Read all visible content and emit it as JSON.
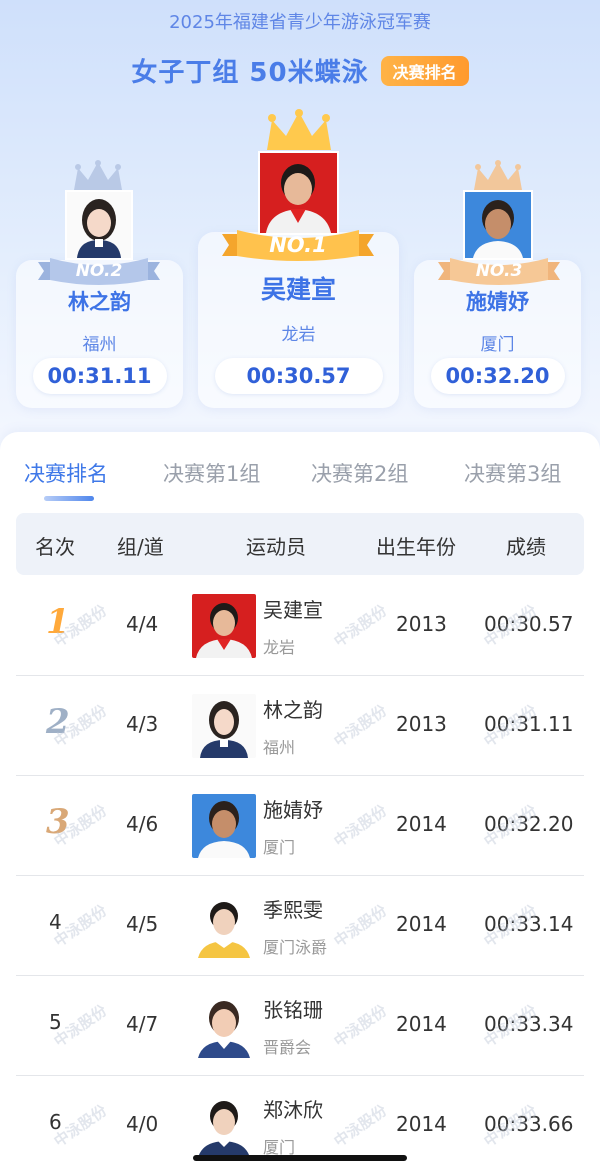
{
  "event": {
    "competition": "2025年福建省青少年游泳冠军赛",
    "title": "女子丁组 50米蝶泳",
    "badge": "决赛排名"
  },
  "podium": {
    "first": {
      "rank_label": "NO.1",
      "name": "吴建宣",
      "city": "龙岩",
      "time": "00:30.57"
    },
    "second": {
      "rank_label": "NO.2",
      "name": "林之韵",
      "city": "福州",
      "time": "00:31.11"
    },
    "third": {
      "rank_label": "NO.3",
      "name": "施婧妤",
      "city": "厦门",
      "time": "00:32.20"
    }
  },
  "tabs": [
    {
      "label": "决赛排名",
      "active": true
    },
    {
      "label": "决赛第1组",
      "active": false
    },
    {
      "label": "决赛第2组",
      "active": false
    },
    {
      "label": "决赛第3组",
      "active": false
    }
  ],
  "table": {
    "headers": [
      "名次",
      "组/道",
      "运动员",
      "出生年份",
      "成绩"
    ],
    "rows": [
      {
        "rank": "1",
        "lane": "4/4",
        "name": "吴建宣",
        "team": "龙岩",
        "year": "2013",
        "result": "00:30.57"
      },
      {
        "rank": "2",
        "lane": "4/3",
        "name": "林之韵",
        "team": "福州",
        "year": "2013",
        "result": "00:31.11"
      },
      {
        "rank": "3",
        "lane": "4/6",
        "name": "施婧妤",
        "team": "厦门",
        "year": "2014",
        "result": "00:32.20"
      },
      {
        "rank": "4",
        "lane": "4/5",
        "name": "季熙雯",
        "team": "厦门泳爵",
        "year": "2014",
        "result": "00:33.14"
      },
      {
        "rank": "5",
        "lane": "4/7",
        "name": "张铭珊",
        "team": "晋爵会",
        "year": "2014",
        "result": "00:33.34"
      },
      {
        "rank": "6",
        "lane": "4/0",
        "name": "郑沐欣",
        "team": "厦门",
        "year": "2014",
        "result": "00:33.66"
      }
    ]
  },
  "watermark": "中泳股份",
  "colors": {
    "accent": "#3f78e8",
    "gold": "#ffa93b",
    "silver": "#9fb0c6",
    "bronze": "#d9a877",
    "badge": "#ff9a2e"
  }
}
